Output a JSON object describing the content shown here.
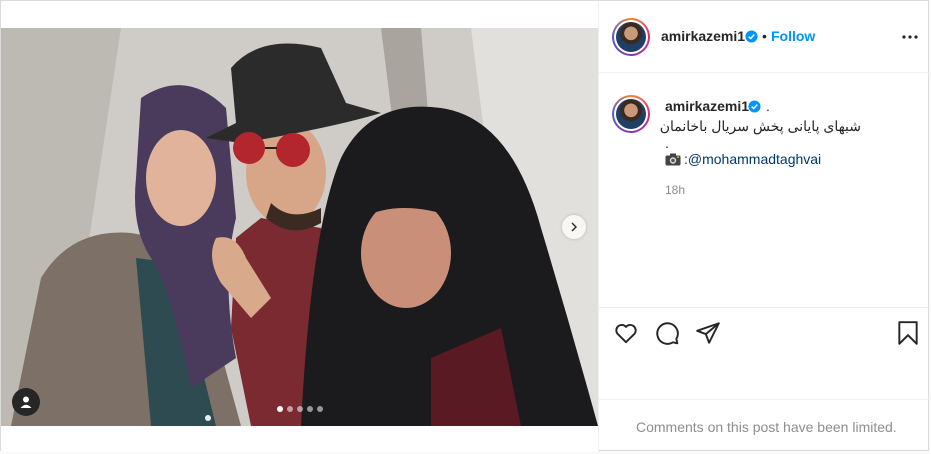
{
  "post": {
    "username": "amirkazemi1",
    "follow_separator": "•",
    "follow_label": "Follow",
    "more_icon": "more-horizontal-icon",
    "verified_color": "#0095f6",
    "follow_color": "#0095f6"
  },
  "caption": {
    "username": "amirkazemi1",
    "trailing": ".",
    "line1": "شبهای پایانی پخش سریال باخانمان",
    "line2": ".",
    "camera_icon": "camera-icon",
    "mention_prefix": ":",
    "mention": "@mohammadtaghvai",
    "time": "18h"
  },
  "carousel": {
    "slide_count": 5,
    "active_slide": 1
  },
  "actions": {
    "like_icon": "heart-icon",
    "comment_icon": "comment-icon",
    "share_icon": "share-icon",
    "save_icon": "bookmark-icon"
  },
  "comments_notice": "Comments on this post have been limited."
}
